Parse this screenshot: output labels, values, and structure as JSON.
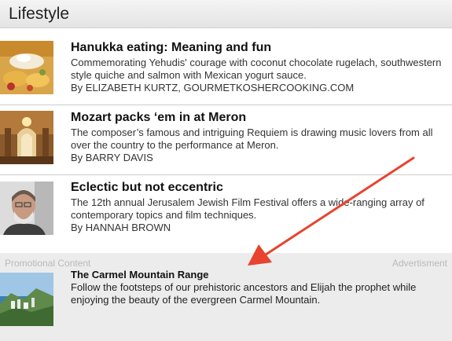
{
  "header": {
    "title": "Lifestyle"
  },
  "articles": [
    {
      "title": "Hanukka eating: Meaning and fun",
      "summary": "Commemorating Yehudis' courage with coconut chocolate rugelach, southwestern style quiche and salmon with Mexican yogurt sauce.",
      "byline": "By ELIZABETH KURTZ, GOURMETKOSHERCOOKING.COM"
    },
    {
      "title": "Mozart packs ‘em in at Meron",
      "summary": "The composer’s famous and intriguing Requiem is drawing music lovers from all over the country to the performance at Meron.",
      "byline": "By BARRY DAVIS"
    },
    {
      "title": "Eclectic but not eccentric",
      "summary": "The 12th annual Jerusalem Jewish Film Festival offers a wide-ranging array of contemporary topics and film techniques.",
      "byline": "By HANNAH BROWN"
    }
  ],
  "promo": {
    "left_label": "Promotional Content",
    "right_label": "Advertisment",
    "title": "The Carmel Mountain Range",
    "summary": "Follow the footsteps of our prehistoric ancestors and Elijah the prophet while enjoying the beauty of the evergreen Carmel Mountain."
  },
  "colors": {
    "arrow": "#e8432e",
    "promo_bg": "#ececec"
  }
}
